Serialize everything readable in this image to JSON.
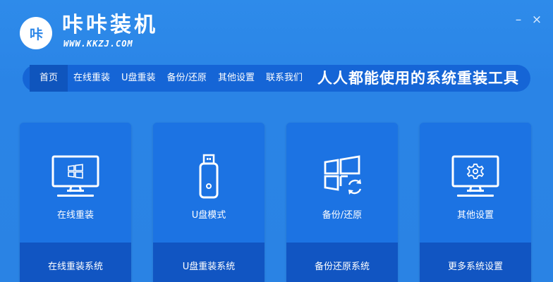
{
  "app": {
    "logo_text": "咔",
    "name": "咔咔装机",
    "url": "WWW.KKZJ.COM",
    "window_controls": {
      "minimize": "–",
      "close": "×"
    }
  },
  "nav": {
    "items": [
      {
        "label": "首页",
        "active": true
      },
      {
        "label": "在线重装",
        "active": false
      },
      {
        "label": "U盘重装",
        "active": false
      },
      {
        "label": "备份/还原",
        "active": false
      },
      {
        "label": "其他设置",
        "active": false
      },
      {
        "label": "联系我们",
        "active": false
      }
    ],
    "slogan": "人人都能使用的系统重装工具"
  },
  "cards": [
    {
      "title": "在线重装",
      "action": "在线重装系统",
      "icon": "monitor-windows-icon"
    },
    {
      "title": "U盘模式",
      "action": "U盘重装系统",
      "icon": "usb-drive-icon"
    },
    {
      "title": "备份/还原",
      "action": "备份还原系统",
      "icon": "windows-restore-icon"
    },
    {
      "title": "其他设置",
      "action": "更多系统设置",
      "icon": "monitor-gear-icon"
    }
  ],
  "colors": {
    "background": "#2a84e6",
    "nav_bar": "#1565d6",
    "nav_active": "#0f55bd",
    "card_top": "#1c73e3",
    "card_bottom": "#1155c2",
    "text": "#ffffff"
  }
}
